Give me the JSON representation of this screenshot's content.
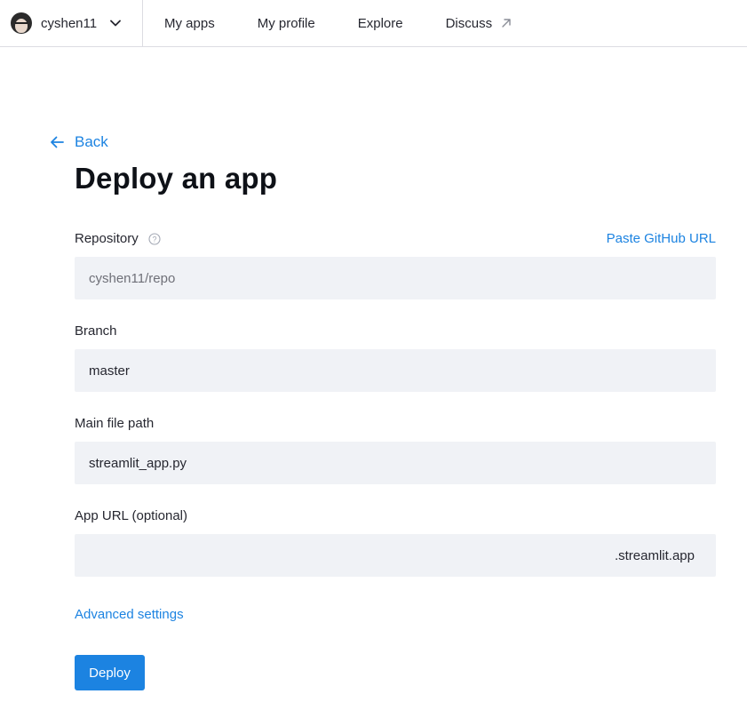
{
  "nav": {
    "username": "cyshen11",
    "items": [
      {
        "label": "My apps"
      },
      {
        "label": "My profile"
      },
      {
        "label": "Explore"
      },
      {
        "label": "Discuss",
        "external": true
      }
    ]
  },
  "back": {
    "label": "Back"
  },
  "page": {
    "title": "Deploy an app"
  },
  "form": {
    "repository": {
      "label": "Repository",
      "value": "cyshen11/repo",
      "paste_link": "Paste GitHub URL"
    },
    "branch": {
      "label": "Branch",
      "value": "master"
    },
    "main_file": {
      "label": "Main file path",
      "value": "streamlit_app.py"
    },
    "app_url": {
      "label": "App URL (optional)",
      "value": "",
      "suffix": ".streamlit.app"
    },
    "advanced_link": "Advanced settings",
    "deploy_label": "Deploy"
  },
  "colors": {
    "accent": "#1c83e1",
    "field_bg": "#f0f2f6",
    "text": "#262730"
  }
}
